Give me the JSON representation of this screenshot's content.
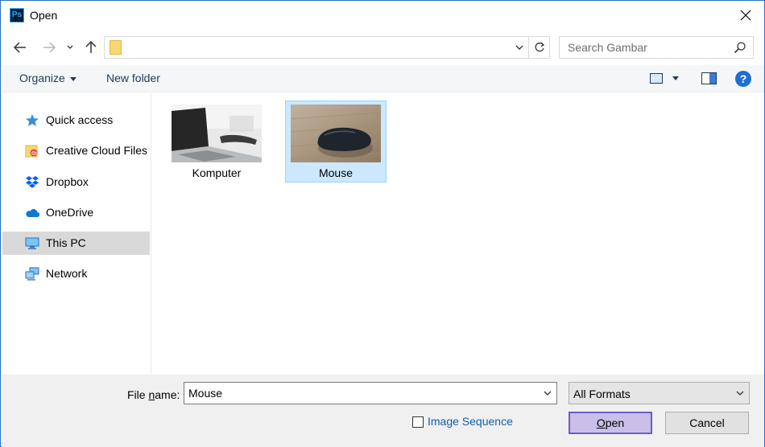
{
  "window": {
    "title": "Open",
    "app_icon_text": "Ps",
    "app_icon_name": "photoshop-icon"
  },
  "search": {
    "placeholder": "Search Gambar"
  },
  "toolbar": {
    "organize_label": "Organize",
    "new_folder_label": "New folder",
    "help_label": "?"
  },
  "navigation": {
    "items": [
      {
        "label": "Quick access",
        "icon": "star-icon"
      },
      {
        "label": "Creative Cloud Files",
        "icon": "creative-cloud-folder-icon"
      },
      {
        "label": "Dropbox",
        "icon": "dropbox-icon"
      },
      {
        "label": "OneDrive",
        "icon": "onedrive-cloud-icon"
      },
      {
        "label": "This PC",
        "icon": "computer-icon",
        "selected": true
      },
      {
        "label": "Network",
        "icon": "network-icon"
      }
    ]
  },
  "files": [
    {
      "name": "Komputer",
      "thumbnail": "laptop-photo",
      "selected": false
    },
    {
      "name": "Mouse",
      "thumbnail": "mouse-photo",
      "selected": true
    }
  ],
  "bottom": {
    "file_name_label_pre": "File ",
    "file_name_label_ul": "n",
    "file_name_label_post": "ame:",
    "file_name_value": "Mouse",
    "format_value": "All Formats",
    "image_sequence_label": "Image Sequence",
    "image_sequence_checked": false,
    "open_label_ul": "O",
    "open_label_rest": "pen",
    "cancel_label": "Cancel"
  },
  "colors": {
    "accent": "#2b6fc0",
    "selection": "#cce8ff",
    "primary_button": "#c9bfe8"
  }
}
